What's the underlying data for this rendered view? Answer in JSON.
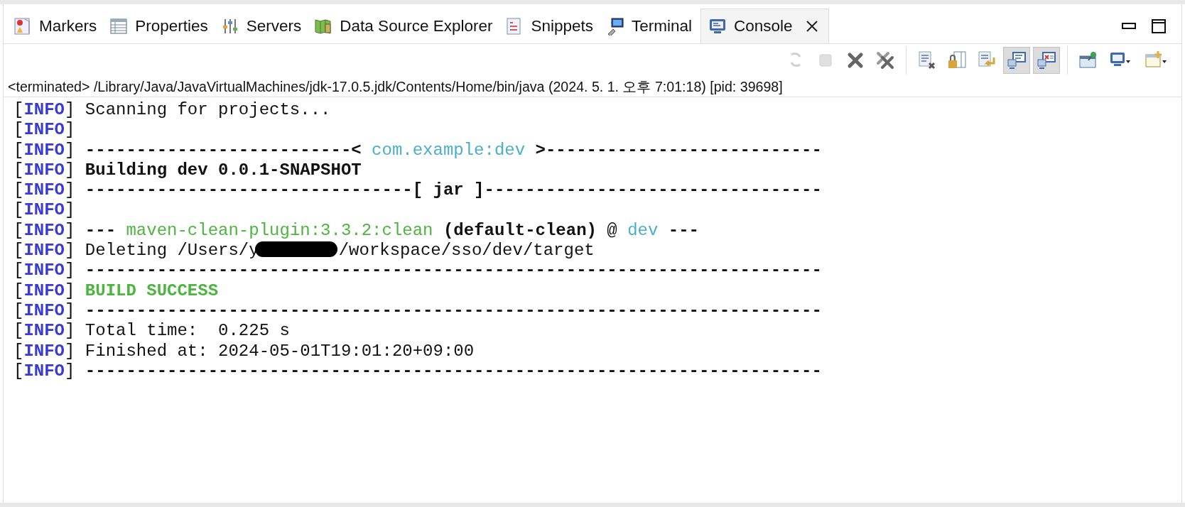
{
  "tabs": [
    {
      "label": "Markers",
      "selected": false
    },
    {
      "label": "Properties",
      "selected": false
    },
    {
      "label": "Servers",
      "selected": false
    },
    {
      "label": "Data Source Explorer",
      "selected": false
    },
    {
      "label": "Snippets",
      "selected": false
    },
    {
      "label": "Terminal",
      "selected": false
    },
    {
      "label": "Console",
      "selected": true
    }
  ],
  "toolbar": [
    {
      "disabled": true,
      "on": false
    },
    {
      "disabled": true,
      "on": false
    },
    {
      "disabled": false,
      "on": false
    },
    {
      "disabled": false,
      "on": false
    },
    {
      "disabled": false,
      "on": false
    },
    {
      "disabled": false,
      "on": false
    },
    {
      "disabled": false,
      "on": false
    },
    {
      "disabled": false,
      "on": true
    },
    {
      "disabled": false,
      "on": true
    },
    {
      "disabled": false,
      "on": false
    },
    {
      "disabled": false,
      "on": false
    },
    {
      "disabled": false,
      "on": false
    }
  ],
  "process_label": "<terminated> /Library/Java/JavaVirtualMachines/jdk-17.0.5.jdk/Contents/Home/bin/java (2024. 5. 1. 오후 7:01:18) [pid: 39698]",
  "console_lines": [
    {
      "segments": [
        {
          "kind": "plain",
          "text": "["
        },
        {
          "kind": "level",
          "text": "INFO"
        },
        {
          "kind": "plain",
          "text": "] Scanning for projects..."
        }
      ]
    },
    {
      "segments": [
        {
          "kind": "plain",
          "text": "["
        },
        {
          "kind": "level",
          "text": "INFO"
        },
        {
          "kind": "plain",
          "text": "]"
        }
      ]
    },
    {
      "segments": [
        {
          "kind": "plain",
          "text": "["
        },
        {
          "kind": "level",
          "text": "INFO"
        },
        {
          "kind": "plain",
          "text": "] "
        },
        {
          "kind": "bold",
          "text": "--------------------------< "
        },
        {
          "kind": "cyan",
          "text": "com.example:dev"
        },
        {
          "kind": "bold",
          "text": " >---------------------------"
        }
      ]
    },
    {
      "segments": [
        {
          "kind": "plain",
          "text": "["
        },
        {
          "kind": "level",
          "text": "INFO"
        },
        {
          "kind": "plain",
          "text": "] "
        },
        {
          "kind": "bold",
          "text": "Building dev 0.0.1-SNAPSHOT"
        }
      ]
    },
    {
      "segments": [
        {
          "kind": "plain",
          "text": "["
        },
        {
          "kind": "level",
          "text": "INFO"
        },
        {
          "kind": "plain",
          "text": "] "
        },
        {
          "kind": "bold",
          "text": "--------------------------------[ jar ]---------------------------------"
        }
      ]
    },
    {
      "segments": [
        {
          "kind": "plain",
          "text": "["
        },
        {
          "kind": "level",
          "text": "INFO"
        },
        {
          "kind": "plain",
          "text": "]"
        }
      ]
    },
    {
      "segments": [
        {
          "kind": "plain",
          "text": "["
        },
        {
          "kind": "level",
          "text": "INFO"
        },
        {
          "kind": "plain",
          "text": "] "
        },
        {
          "kind": "bold",
          "text": "--- "
        },
        {
          "kind": "green",
          "text": "maven-clean-plugin:3.3.2:clean"
        },
        {
          "kind": "bold",
          "text": " (default-clean)"
        },
        {
          "kind": "plain",
          "text": " @ "
        },
        {
          "kind": "cyan",
          "text": "dev"
        },
        {
          "kind": "bold",
          "text": " ---"
        }
      ]
    },
    {
      "segments": [
        {
          "kind": "plain",
          "text": "["
        },
        {
          "kind": "level",
          "text": "INFO"
        },
        {
          "kind": "plain",
          "text": "] Deleting /Users/y"
        },
        {
          "kind": "redaction"
        },
        {
          "kind": "plain",
          "text": "/workspace/sso/dev/target"
        }
      ]
    },
    {
      "segments": [
        {
          "kind": "plain",
          "text": "["
        },
        {
          "kind": "level",
          "text": "INFO"
        },
        {
          "kind": "plain",
          "text": "] "
        },
        {
          "kind": "bold",
          "text": "------------------------------------------------------------------------"
        }
      ]
    },
    {
      "segments": [
        {
          "kind": "plain",
          "text": "["
        },
        {
          "kind": "level",
          "text": "INFO"
        },
        {
          "kind": "plain",
          "text": "] "
        },
        {
          "kind": "success",
          "text": "BUILD SUCCESS"
        }
      ]
    },
    {
      "segments": [
        {
          "kind": "plain",
          "text": "["
        },
        {
          "kind": "level",
          "text": "INFO"
        },
        {
          "kind": "plain",
          "text": "] "
        },
        {
          "kind": "bold",
          "text": "------------------------------------------------------------------------"
        }
      ]
    },
    {
      "segments": [
        {
          "kind": "plain",
          "text": "["
        },
        {
          "kind": "level",
          "text": "INFO"
        },
        {
          "kind": "plain",
          "text": "] Total time:  0.225 s"
        }
      ]
    },
    {
      "segments": [
        {
          "kind": "plain",
          "text": "["
        },
        {
          "kind": "level",
          "text": "INFO"
        },
        {
          "kind": "plain",
          "text": "] Finished at: 2024-05-01T19:01:20+09:00"
        }
      ]
    },
    {
      "segments": [
        {
          "kind": "plain",
          "text": "["
        },
        {
          "kind": "level",
          "text": "INFO"
        },
        {
          "kind": "plain",
          "text": "] "
        },
        {
          "kind": "bold",
          "text": "------------------------------------------------------------------------"
        }
      ]
    }
  ]
}
